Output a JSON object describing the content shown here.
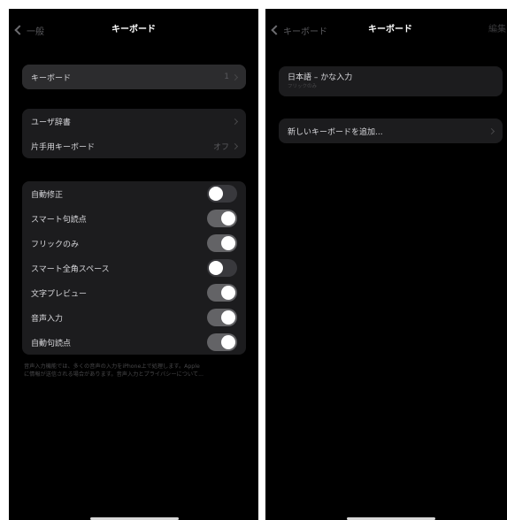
{
  "left": {
    "nav": {
      "back_label": "一般",
      "title": "キーボード"
    },
    "keyboards_row": {
      "label": "キーボード",
      "value": "1"
    },
    "group2": [
      {
        "label": "ユーザ辞書",
        "value": ""
      },
      {
        "label": "片手用キーボード",
        "value": "オフ"
      }
    ],
    "toggles": [
      {
        "label": "自動修正",
        "state": "off"
      },
      {
        "label": "スマート句読点",
        "state": "on"
      },
      {
        "label": "フリックのみ",
        "state": "on"
      },
      {
        "label": "スマート全角スペース",
        "state": "off"
      },
      {
        "label": "文字プレビュー",
        "state": "on"
      },
      {
        "label": "音声入力",
        "state": "on"
      },
      {
        "label": "自動句読点",
        "state": "on"
      }
    ],
    "footer_line1": "音声入力機能では、多くの音声の入力をiPhone上で処理します。Apple",
    "footer_line2": "に情報が送信される場合があります。音声入力とプライバシーについて..."
  },
  "right": {
    "nav": {
      "back_label": "キーボード",
      "title": "キーボード",
      "edit_label": "編集"
    },
    "keyboard_item": {
      "title": "日本語 – かな入力",
      "subtitle": "フリックのみ"
    },
    "add_row": {
      "label": "新しいキーボードを追加..."
    }
  },
  "colors": {
    "background": "#000000",
    "cell": "#1c1c1e",
    "toggle_on": "#636366",
    "toggle_off": "#39393d"
  },
  "icons": [
    "chevron-left-icon",
    "chevron-right-icon"
  ]
}
